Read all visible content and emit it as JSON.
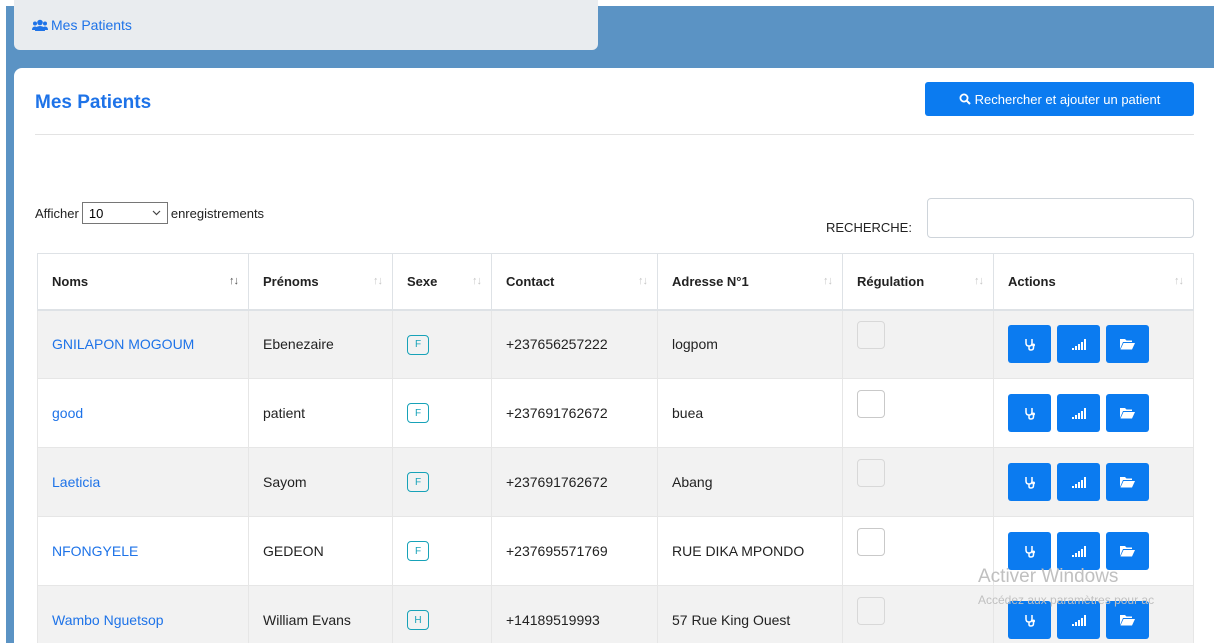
{
  "breadcrumb": {
    "icon": "users-icon",
    "label": "Mes Patients"
  },
  "card": {
    "title": "Mes Patients",
    "search_add_button": "Rechercher et ajouter un patient"
  },
  "length_control": {
    "prefix": "Afficher",
    "value": "10",
    "suffix": "enregistrements"
  },
  "search": {
    "label": "RECHERCHE:",
    "value": ""
  },
  "table": {
    "columns": [
      "Noms",
      "Prénoms",
      "Sexe",
      "Contact",
      "Adresse N°1",
      "Régulation",
      "Actions"
    ],
    "rows": [
      {
        "nom": "GNILAPON MOGOUM",
        "prenom": "Ebenezaire",
        "sexe": "F",
        "contact": "+237656257222",
        "adresse": "logpom"
      },
      {
        "nom": "good",
        "prenom": "patient",
        "sexe": "F",
        "contact": "+237691762672",
        "adresse": "buea"
      },
      {
        "nom": "Laeticia",
        "prenom": "Sayom",
        "sexe": "F",
        "contact": "+237691762672",
        "adresse": "Abang"
      },
      {
        "nom": "NFONGYELE",
        "prenom": "GEDEON",
        "sexe": "F",
        "contact": "+237695571769",
        "adresse": "RUE DIKA MPONDO"
      },
      {
        "nom": "Wambo Nguetsop",
        "prenom": "William Evans",
        "sexe": "H",
        "contact": "+14189519993",
        "adresse": "57 Rue King Ouest"
      }
    ],
    "action_icons": [
      "stethoscope-icon",
      "signal-bars-icon",
      "folder-open-icon"
    ]
  },
  "watermark": {
    "title": "Activer Windows",
    "subtitle": "Accédez aux paramètres pour ac"
  },
  "colors": {
    "primary": "#0b7bf0",
    "link": "#1e73e8",
    "badge": "#17a2b8",
    "background": "#5b93c4"
  }
}
